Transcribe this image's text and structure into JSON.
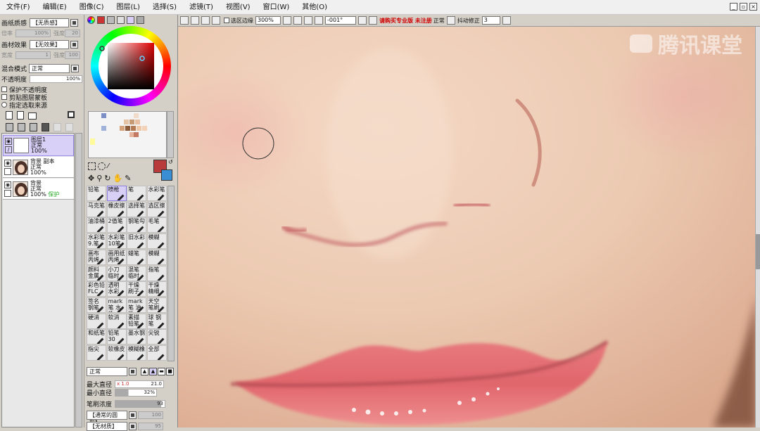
{
  "menu": [
    "文件(F)",
    "编辑(E)",
    "图像(C)",
    "图层(L)",
    "选择(S)",
    "滤镜(T)",
    "视图(V)",
    "窗口(W)",
    "其他(O)"
  ],
  "left": {
    "paper_label": "画纸质感",
    "paper_value": "【无质感】",
    "paper_scale_label": "倍率",
    "paper_scale": "100%",
    "paper_strength_label": "强度",
    "paper_strength": "20",
    "effect_label": "画材效果",
    "effect_value": "【无效果】",
    "effect_width_label": "宽度",
    "effect_width": "1",
    "effect_strength_label": "强度",
    "effect_strength": "100",
    "blend_label": "混合模式",
    "blend_value": "正常",
    "opacity_label": "不透明度",
    "opacity": "100%",
    "opts": [
      "保护不透明度",
      "剪贴图层蒙板",
      "指定选取来源"
    ]
  },
  "layers": [
    {
      "name": "图层1",
      "mode": "正常",
      "opacity": "100%",
      "extra": ""
    },
    {
      "name": "背景 副本",
      "mode": "正常",
      "opacity": "100%",
      "extra": ""
    },
    {
      "name": "背景",
      "mode": "正常",
      "opacity": "100%",
      "extra": "保护"
    }
  ],
  "tools": [
    [
      "铅笔",
      "喷枪",
      "笔",
      "水彩笔"
    ],
    [
      "马克笔",
      "橡皮擦",
      "选择笔",
      "选区擦"
    ],
    [
      "油漆桶",
      "2值笔",
      "钢笔勾",
      "毛笔"
    ],
    [
      "水彩笔 9.笔",
      "水彩笔 10笔",
      "旧水彩",
      "模糊"
    ],
    [
      "画布 丙烯",
      "画用纸 丙烯",
      "蜡笔",
      "模糊"
    ],
    [
      "颜料 金属",
      "小刀 临时",
      "混笔 临时",
      "指笔"
    ],
    [
      "彩色铅 FLC",
      "透明 水彩",
      "干燥 刷子",
      "干燥 精细"
    ],
    [
      "签名 钢笔",
      "mark笔 水性",
      "mark笔 油性",
      "天空 笔刷"
    ],
    [
      "硬消",
      "软消",
      "素描 铅笔",
      "球 钢笔"
    ],
    [
      "和纸笔",
      "铅笔30",
      "墨水钢",
      "尖锐"
    ],
    [
      "指尖",
      "软橡皮",
      "模糊橡",
      "全部"
    ]
  ],
  "brush": {
    "mode": "正常",
    "max_label": "最大直径",
    "max_mult": "x 1.0",
    "max_value": "21.0",
    "min_label": "最小直径",
    "min_value": "32%",
    "density_label": "笔刷浓度",
    "density_value": "93",
    "shape": "【通常的圆形】",
    "shape_value": "100",
    "material": "【无材质】",
    "material_value": "95"
  },
  "toolbar": {
    "select_edge": "选区边缘",
    "zoom": "300%",
    "angle": "-001°",
    "red_text": "请购买专业版 未注册",
    "mode": "正常",
    "stab_label": "抖动修正",
    "stab_value": "3"
  },
  "watermark": "腾讯课堂",
  "colors": {
    "accent": "#d7cff6",
    "current_color": "#b83a3a",
    "secondary_color": "#3a8fd4",
    "toolbar_red": "#d00000"
  }
}
